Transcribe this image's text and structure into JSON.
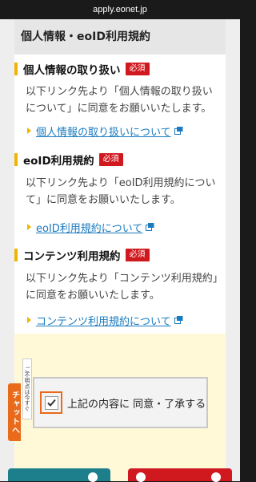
{
  "browser": {
    "url": "apply.eonet.jp"
  },
  "card": {
    "header": "個人情報・eoID利用規約"
  },
  "sections": [
    {
      "title": "個人情報の取り扱い",
      "badge": "必須",
      "desc": "以下リンク先より「個人情報の取り扱いについて」に同意をお願いいたします。",
      "link": "個人情報の取り扱いについて"
    },
    {
      "title": "eoID利用規約",
      "badge": "必須",
      "desc": "以下リンク先より「eoID利用規約について」に同意をお願いいたします。",
      "link": "eoID利用規約について"
    },
    {
      "title": "コンテンツ利用規約",
      "badge": "必須",
      "desc": "以下リンク先より「コンテンツ利用規約」に同意をお願いいたします。",
      "link": "コンテンツ利用規約について"
    }
  ],
  "agree": {
    "label": "上記の内容に 同意・了承する"
  },
  "chat": {
    "label": "チャットへ",
    "note": "ご不明点は今すぐ"
  },
  "colors": {
    "accent": "#f1b400",
    "required": "#d0181f",
    "link": "#1a7bbf",
    "checkbox_focus": "#e86a1a"
  }
}
